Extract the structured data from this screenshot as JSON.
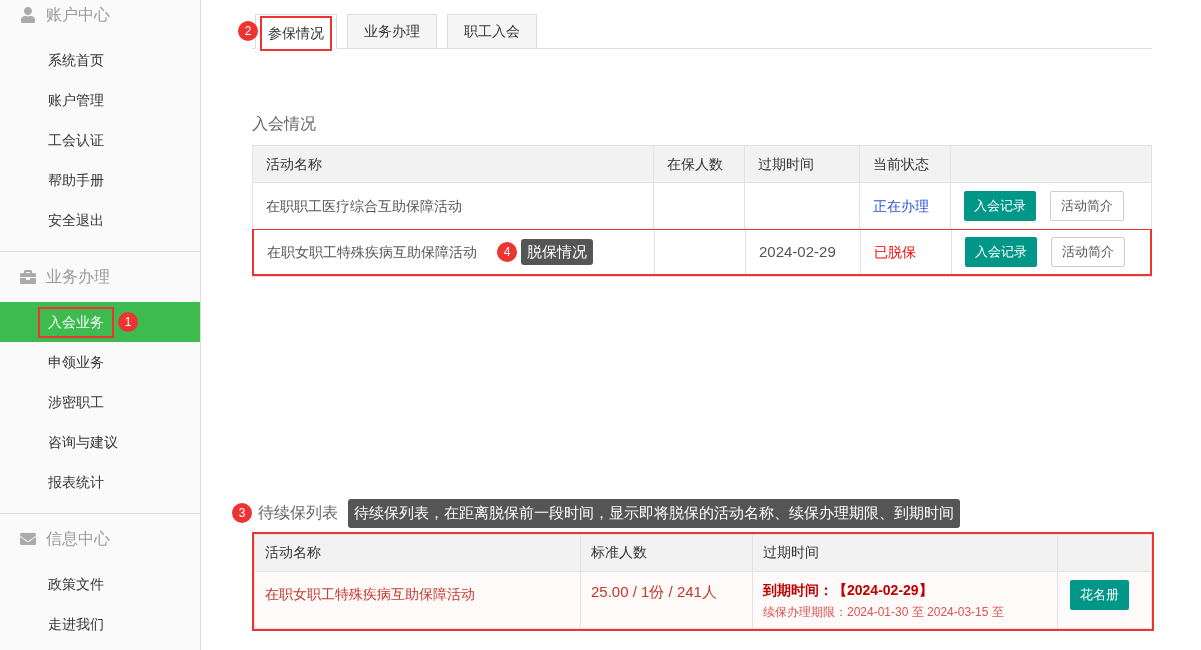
{
  "sidebar": {
    "groups": [
      {
        "title": "账户中心",
        "kind": "account",
        "items": [
          {
            "label": "系统首页",
            "selected": false
          },
          {
            "label": "账户管理",
            "selected": false
          },
          {
            "label": "工会认证",
            "selected": false
          },
          {
            "label": "帮助手册",
            "selected": false
          },
          {
            "label": "安全退出",
            "selected": false
          }
        ]
      },
      {
        "title": "业务办理",
        "kind": "business",
        "items": [
          {
            "label": "入会业务",
            "selected": true,
            "annotation": "1"
          },
          {
            "label": "申领业务",
            "selected": false
          },
          {
            "label": "涉密职工",
            "selected": false
          },
          {
            "label": "咨询与建议",
            "selected": false
          },
          {
            "label": "报表统计",
            "selected": false
          }
        ]
      },
      {
        "title": "信息中心",
        "kind": "info",
        "items": [
          {
            "label": "政策文件",
            "selected": false
          },
          {
            "label": "走进我们",
            "selected": false
          }
        ]
      }
    ]
  },
  "tabs": [
    {
      "label": "参保情况",
      "selected": true,
      "annotation": "2"
    },
    {
      "label": "业务办理",
      "selected": false
    },
    {
      "label": "职工入会",
      "selected": false
    }
  ],
  "membership": {
    "title": "入会情况",
    "columns": [
      "活动名称",
      "在保人数",
      "过期时间",
      "当前状态"
    ],
    "rows": [
      {
        "name": "在职职工医疗综合互助保障活动",
        "status": "正在办理",
        "kind": "processing",
        "actions": [
          "入会记录",
          "活动简介"
        ],
        "highlighted": false
      },
      {
        "name": "在职女职工特殊疾病互助保障活动",
        "expiry": "2024-02-29",
        "status": "已脱保",
        "kind": "lapsed",
        "actions": [
          "入会记录",
          "活动简介"
        ],
        "highlighted": true,
        "annotation": {
          "number": "4",
          "note": "脱保情况"
        }
      }
    ]
  },
  "renewal": {
    "title": "待续保列表",
    "highlighted": true,
    "annotation": {
      "number": "3",
      "note": "待续保列表，在距离脱保前一段时间，显示即将脱保的活动名称、续保办理期限、到期时间"
    },
    "columns": [
      "活动名称",
      "标准人数",
      "过期时间"
    ],
    "rows": [
      {
        "name": "在职女职工特殊疾病互助保障活动",
        "quota": "25.00 / 1份 / 241人",
        "due": "到期时间：【2024-02-29】",
        "period": "续保办理期限：2024-01-30 至 2024-03-15 至",
        "action": "花名册"
      }
    ]
  }
}
